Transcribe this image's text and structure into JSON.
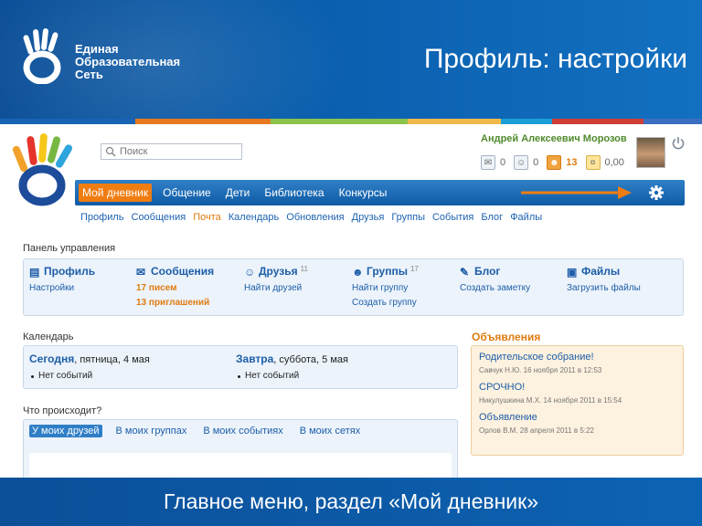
{
  "slide": {
    "brand": [
      "Единая",
      "Образовательная",
      "Сеть"
    ],
    "title": "Профиль: настройки",
    "footer": "Главное меню, раздел «Мой дневник»",
    "stripe_colors": [
      "#1763b4",
      "#e8791f",
      "#8bc34a",
      "#f0b84a",
      "#1a9fd8",
      "#cf3e35",
      "#3b6ec2"
    ]
  },
  "search": {
    "placeholder": "Поиск"
  },
  "user": {
    "name": "Андрей Алексеевич Морозов",
    "counters": [
      {
        "icon": "envelope-icon",
        "value": "0"
      },
      {
        "icon": "person-icon",
        "value": "0"
      },
      {
        "icon": "people-icon",
        "value": "13",
        "highlight": true
      },
      {
        "icon": "coins-icon",
        "value": "0,00"
      }
    ]
  },
  "main_nav": {
    "items": [
      "Мой дневник",
      "Общение",
      "Дети",
      "Библиотека",
      "Конкурсы"
    ],
    "active": "Мой дневник"
  },
  "sub_nav": {
    "items": [
      "Профиль",
      "Сообщения",
      "Почта",
      "Календарь",
      "Обновления",
      "Друзья",
      "Группы",
      "События",
      "Блог",
      "Файлы"
    ],
    "active": "Почта"
  },
  "control_panel": {
    "title": "Панель управления",
    "columns": [
      {
        "label": "Профиль",
        "icon": "id-card-icon",
        "links": [
          "Настройки"
        ]
      },
      {
        "label": "Сообщения",
        "icon": "envelope-icon",
        "links": [
          "17 писем",
          "13 приглашений"
        ],
        "highlight": true
      },
      {
        "label": "Друзья",
        "icon": "person-icon",
        "count": "11",
        "links": [
          "Найти друзей"
        ]
      },
      {
        "label": "Группы",
        "icon": "group-icon",
        "count": "17",
        "links": [
          "Найти группу",
          "Создать группу"
        ]
      },
      {
        "label": "Блог",
        "icon": "pencil-icon",
        "links": [
          "Создать заметку"
        ]
      },
      {
        "label": "Файлы",
        "icon": "files-icon",
        "links": [
          "Загрузить файлы"
        ]
      }
    ]
  },
  "calendar": {
    "title": "Календарь",
    "days": [
      {
        "name": "Сегодня",
        "date": ", пятница, 4 мая",
        "event": "Нет событий"
      },
      {
        "name": "Завтра",
        "date": ", суббота, 5 мая",
        "event": "Нет событий"
      }
    ]
  },
  "ads": {
    "title": "Объявления",
    "items": [
      {
        "title": "Родительское собрание!",
        "meta": "Савчук Н.Ю. 16 ноября 2011 в 12:53"
      },
      {
        "title": "СРОЧНО!",
        "meta": "Никулушкина М.Х. 14 ноября 2011 в 15:54"
      },
      {
        "title": "Объявление",
        "meta": "Орлов В.М. 28 апреля 2011 в 5:22"
      }
    ]
  },
  "whats_up": {
    "title": "Что происходит?",
    "tabs": [
      "У моих друзей",
      "В моих группах",
      "В моих событиях",
      "В моих сетях"
    ],
    "active": "У моих друзей"
  }
}
